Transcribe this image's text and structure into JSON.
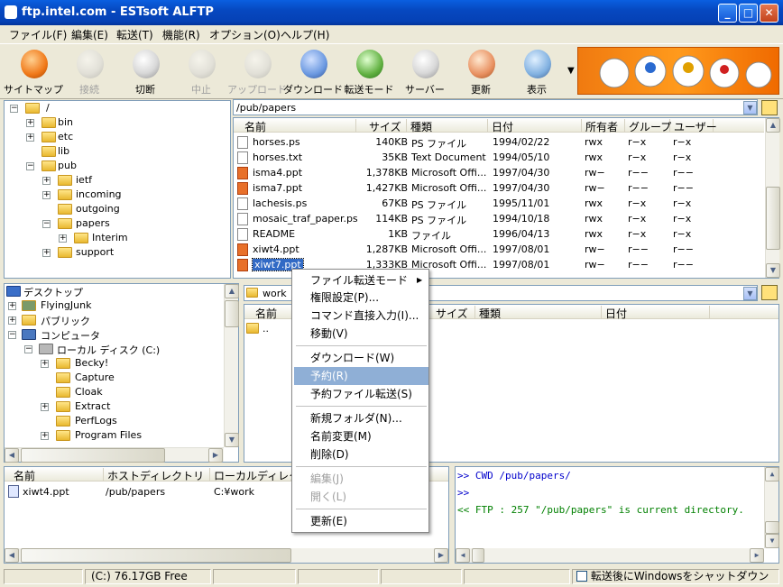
{
  "window": {
    "title": "ftp.intel.com - ESTsoft ALFTP"
  },
  "menu": [
    "ファイル(F)",
    "編集(E)",
    "転送(T)",
    "機能(R)",
    "オプション(O)",
    "ヘルプ(H)"
  ],
  "toolbar": [
    {
      "label": "サイトマップ",
      "disabled": false
    },
    {
      "label": "接続",
      "disabled": true
    },
    {
      "label": "切断",
      "disabled": false
    },
    {
      "label": "中止",
      "disabled": true
    },
    {
      "label": "アップロード",
      "disabled": true
    },
    {
      "label": "ダウンロード",
      "disabled": false
    },
    {
      "label": "転送モード",
      "disabled": false
    },
    {
      "label": "サーバー",
      "disabled": false
    },
    {
      "label": "更新",
      "disabled": false
    },
    {
      "label": "表示",
      "disabled": false
    }
  ],
  "remote_tree": [
    "/",
    "bin",
    "etc",
    "lib",
    "pub",
    "ietf",
    "incoming",
    "outgoing",
    "papers",
    "Interim",
    "support"
  ],
  "remote_path": "/pub/papers",
  "remote_columns": [
    "名前",
    "サイズ",
    "種類",
    "日付",
    "所有者",
    "グループ",
    "ユーザー"
  ],
  "remote_files": [
    [
      "horses.ps",
      "140KB",
      "PS ファイル",
      "1994/02/22",
      "rwx",
      "r−x",
      "r−x"
    ],
    [
      "horses.txt",
      "35KB",
      "Text Document",
      "1994/05/10",
      "rwx",
      "r−x",
      "r−x"
    ],
    [
      "isma4.ppt",
      "1,378KB",
      "Microsoft Offi...",
      "1997/04/30",
      "rw−",
      "r−−",
      "r−−"
    ],
    [
      "isma7.ppt",
      "1,427KB",
      "Microsoft Offi...",
      "1997/04/30",
      "rw−",
      "r−−",
      "r−−"
    ],
    [
      "lachesis.ps",
      "67KB",
      "PS ファイル",
      "1995/11/01",
      "rwx",
      "r−x",
      "r−x"
    ],
    [
      "mosaic_traf_paper.ps",
      "114KB",
      "PS ファイル",
      "1994/10/18",
      "rwx",
      "r−x",
      "r−x"
    ],
    [
      "README",
      "1KB",
      "ファイル",
      "1996/04/13",
      "rwx",
      "r−x",
      "r−x"
    ],
    [
      "xiwt4.ppt",
      "1,287KB",
      "Microsoft Offi...",
      "1997/08/01",
      "rw−",
      "r−−",
      "r−−"
    ],
    [
      "xiwt7.ppt",
      "1,333KB",
      "Microsoft Offi...",
      "1997/08/01",
      "rw−",
      "r−−",
      "r−−"
    ]
  ],
  "local_tree": [
    "デスクトップ",
    "FlyingJunk",
    "パブリック",
    "コンピュータ",
    "ローカル ディスク (C:)",
    "Becky!",
    "Capture",
    "Cloak",
    "Extract",
    "PerfLogs",
    "Program Files"
  ],
  "local_path": "work",
  "local_columns": [
    "名前",
    "サイズ",
    "種類",
    "日付"
  ],
  "local_files": [
    ".."
  ],
  "queue_columns": [
    "名前",
    "ホストディレクトリ",
    "ローカルディレクトリ"
  ],
  "queue_rows": [
    [
      "xiwt4.ppt",
      "/pub/papers",
      "C:¥work"
    ]
  ],
  "log": [
    "&gt;&gt; CWD /pub/papers/",
    "&gt;&gt;",
    "&lt;&lt; FTP : 257 \"/pub/papers\" is current directory."
  ],
  "context_menu": [
    "ファイル転送モード",
    "権限設定(P)...",
    "コマンド直接入力(I)...",
    "移動(V)",
    "ダウンロード(W)",
    "予約(R)",
    "予約ファイル転送(S)",
    "新規フォルダ(N)...",
    "名前変更(M)",
    "削除(D)",
    "編集(J)",
    "開く(L)",
    "更新(E)"
  ],
  "status": {
    "drive": "(C:)   76.17GB Free",
    "shutdown": "転送後にWindowsをシャットダウン"
  },
  "colors": {
    "title": "#0648c0",
    "selection": "#316ac5",
    "menu_highlight": "#8fafd6",
    "log_blue": "#0000cc",
    "log_green": "#008000"
  }
}
